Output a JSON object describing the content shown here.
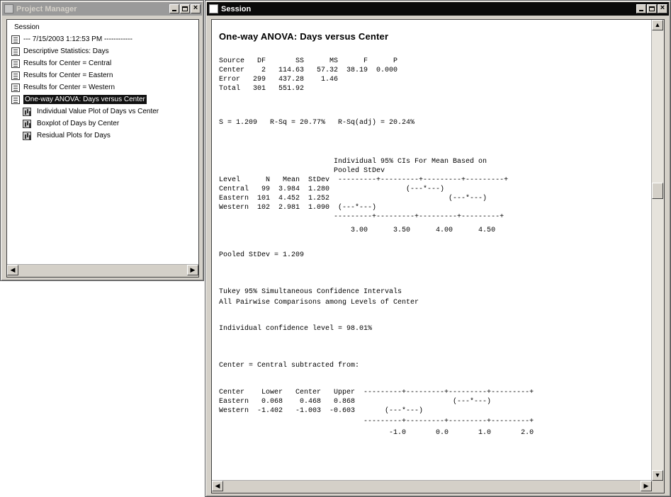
{
  "project_manager": {
    "title": "Project Manager",
    "root_label": "Session",
    "items": [
      {
        "label": "---  7/15/2003 1:12:53 PM  ------------",
        "type": "doc",
        "level": 1
      },
      {
        "label": "Descriptive Statistics: Days",
        "type": "doc",
        "level": 1
      },
      {
        "label": "Results for Center = Central",
        "type": "doc",
        "level": 1
      },
      {
        "label": "Results for Center = Eastern",
        "type": "doc",
        "level": 1
      },
      {
        "label": "Results for Center = Western",
        "type": "doc",
        "level": 1
      },
      {
        "label": "One-way ANOVA: Days versus Center",
        "type": "doc",
        "level": 1,
        "selected": true
      },
      {
        "label": "Individual Value Plot of Days vs Center",
        "type": "graph",
        "level": 2
      },
      {
        "label": "Boxplot of Days by Center",
        "type": "graph",
        "level": 2
      },
      {
        "label": "Residual Plots for Days",
        "type": "graph",
        "level": 2
      }
    ]
  },
  "session": {
    "title": "Session",
    "heading": "One-way ANOVA: Days versus Center",
    "anova_table": {
      "header": "Source   DF       SS      MS      F      P",
      "rows": [
        "Center    2   114.63   57.32  38.19  0.000",
        "Error   299   437.28    1.46",
        "Total   301   551.92"
      ]
    },
    "summary_line": "S = 1.209   R-Sq = 20.77%   R-Sq(adj) = 20.24%",
    "ci_block": [
      "                           Individual 95% CIs For Mean Based on",
      "                           Pooled StDev",
      "Level      N   Mean  StDev  ---------+---------+---------+---------+",
      "Central   99  3.984  1.280                  (---*---)",
      "Eastern  101  4.452  1.252                            (---*---)",
      "Western  102  2.981  1.090  (---*---)",
      "                           ---------+---------+---------+---------+",
      "                               3.00      3.50      4.00      4.50"
    ],
    "pooled_stdev": "Pooled StDev = 1.209",
    "tukey_title": [
      "Tukey 95% Simultaneous Confidence Intervals",
      "All Pairwise Comparisons among Levels of Center"
    ],
    "individual_confidence": "Individual confidence level = 98.01%",
    "subtracted_from": "Center = Central subtracted from:",
    "tukey_block": [
      "Center    Lower   Center   Upper  ---------+---------+---------+---------+",
      "Eastern   0.068    0.468   0.868                       (---*---)",
      "Western  -1.402   -1.003  -0.603       (---*---)",
      "                                  ---------+---------+---------+---------+",
      "                                        -1.0       0.0       1.0       2.0"
    ]
  },
  "colors": {
    "active_title": "#0a0a0a",
    "inactive_title": "#9a9a9a",
    "window_face": "#d4d0c8",
    "selected_item": "#111111"
  }
}
